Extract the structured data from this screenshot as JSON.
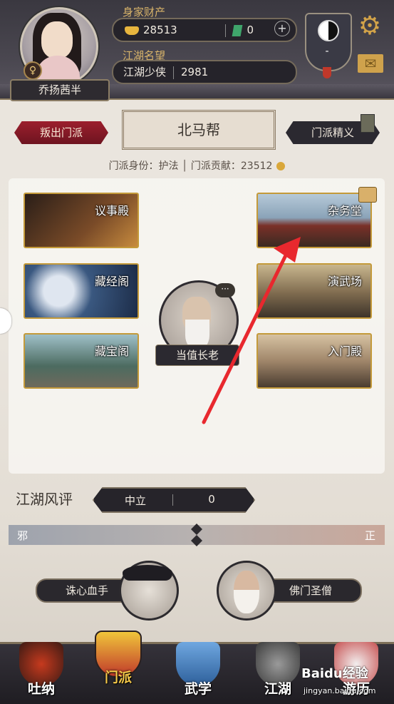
{
  "player": {
    "name": "乔扬茜半",
    "gender_symbol": "♀"
  },
  "wealth": {
    "label": "身家财产",
    "silver": "28513",
    "jade": "0",
    "add": "+"
  },
  "fame": {
    "label": "江湖名望",
    "title": "江湖少侠",
    "value": "2981"
  },
  "emblem": {
    "value": "-"
  },
  "icons": {
    "settings": "⚙",
    "mail": "✉"
  },
  "sect": {
    "betray_label": "叛出门派",
    "name": "北马帮",
    "essence_label": "门派精义",
    "identity_text": "门派身份：护法 │ 门派贡献：23512"
  },
  "buildings": [
    {
      "label": "议事殿"
    },
    {
      "label": "藏经阁"
    },
    {
      "label": "藏宝阁"
    },
    {
      "label": "杂务堂"
    },
    {
      "label": "演武场"
    },
    {
      "label": "入门殿"
    }
  ],
  "elder": {
    "label": "当值长老",
    "bubble": "···"
  },
  "reputation": {
    "title": "江湖风评",
    "status": "中立",
    "value": "0",
    "left_label": "邪",
    "right_label": "正"
  },
  "characters": [
    {
      "label": "诛心血手"
    },
    {
      "label": "佛门圣僧"
    }
  ],
  "nav": [
    {
      "label": "吐纳"
    },
    {
      "label": "门派"
    },
    {
      "label": "武学"
    },
    {
      "label": "江湖"
    },
    {
      "label": "游历"
    }
  ],
  "watermark": {
    "brand": "Baidu经验",
    "url": "jingyan.baidu.com"
  },
  "colors": {
    "accent_gold": "#c49a3a",
    "betray_red": "#9c1f2d",
    "arrow_red": "#e8282e"
  }
}
